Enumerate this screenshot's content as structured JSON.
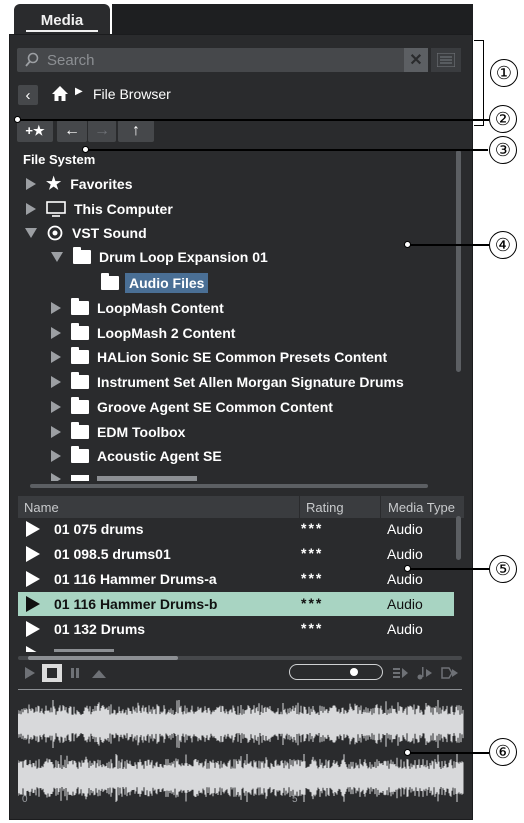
{
  "tab": {
    "label": "Media"
  },
  "search": {
    "placeholder": "Search"
  },
  "breadcrumb": {
    "label": "File Browser"
  },
  "tree": {
    "root_title": "File System",
    "items": [
      {
        "label": "Favorites",
        "icon": "star-icon",
        "expanded": false
      },
      {
        "label": "This Computer",
        "icon": "monitor-icon",
        "expanded": false
      },
      {
        "label": "VST Sound",
        "icon": "vst-sound-icon",
        "expanded": true
      },
      {
        "label": "Drum Loop Expansion 01",
        "icon": "folder-icon",
        "expanded": true
      },
      {
        "label": "Audio Files",
        "icon": "folder-icon",
        "selected": true
      },
      {
        "label": "LoopMash Content",
        "icon": "folder-icon"
      },
      {
        "label": "LoopMash 2 Content",
        "icon": "folder-icon"
      },
      {
        "label": "HALion Sonic SE Common Presets Content",
        "icon": "folder-icon"
      },
      {
        "label": "Instrument Set Allen Morgan Signature Drums",
        "icon": "folder-icon"
      },
      {
        "label": "Groove Agent SE Common Content",
        "icon": "folder-icon"
      },
      {
        "label": "EDM Toolbox",
        "icon": "folder-icon"
      },
      {
        "label": "Acoustic Agent SE",
        "icon": "folder-icon"
      }
    ]
  },
  "results": {
    "columns": [
      "Name",
      "Rating",
      "Media Type"
    ],
    "rows": [
      {
        "name": "01 075 drums",
        "rating": "***",
        "type": "Audio"
      },
      {
        "name": "01 098.5 drums01",
        "rating": "***",
        "type": "Audio"
      },
      {
        "name": "01 116 Hammer Drums-a",
        "rating": "***",
        "type": "Audio"
      },
      {
        "name": "01 116 Hammer Drums-b",
        "rating": "***",
        "type": "Audio",
        "selected": true
      },
      {
        "name": "01 132 Drums",
        "rating": "***",
        "type": "Audio"
      }
    ]
  },
  "waveform": {
    "start_label": "0",
    "mid_label": "5"
  },
  "callouts": [
    "①",
    "②",
    "③",
    "④",
    "⑤",
    "⑥"
  ],
  "colors": {
    "panel": "#2a2b2d",
    "selected_row": "#a8d4c2",
    "selected_folder": "#4a6f95"
  }
}
